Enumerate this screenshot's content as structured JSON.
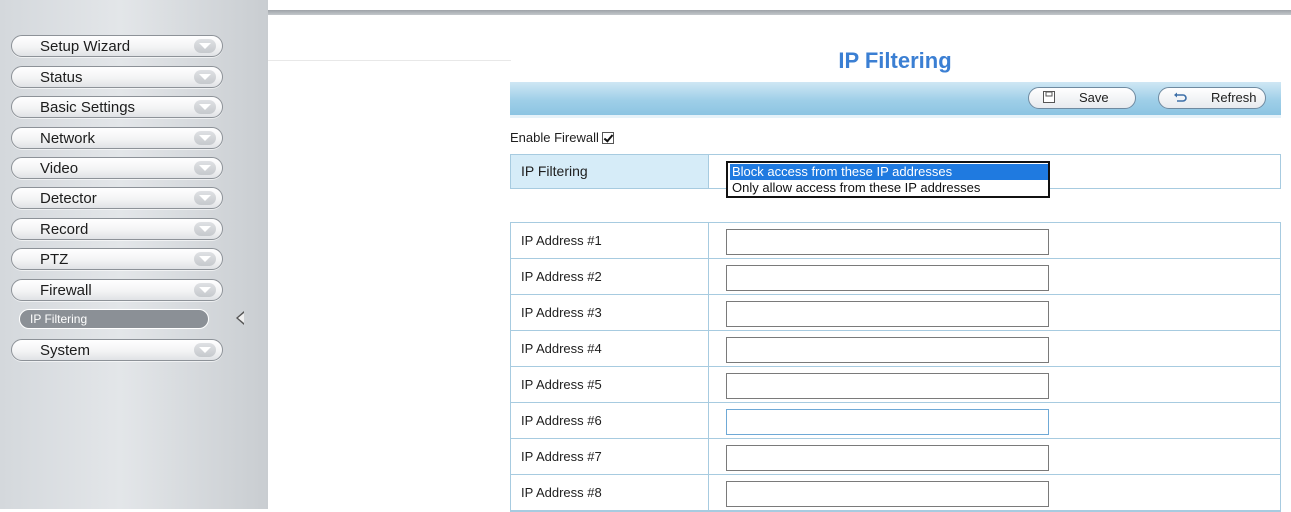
{
  "sidebar": {
    "items": [
      {
        "label": "Setup Wizard"
      },
      {
        "label": "Status"
      },
      {
        "label": "Basic Settings"
      },
      {
        "label": "Network"
      },
      {
        "label": "Video"
      },
      {
        "label": "Detector"
      },
      {
        "label": "Record"
      },
      {
        "label": "PTZ"
      },
      {
        "label": "Firewall"
      },
      {
        "label": "System"
      }
    ],
    "sub_item": {
      "label": "IP Filtering"
    }
  },
  "main": {
    "title": "IP Filtering",
    "toolbar": {
      "save_label": "Save",
      "refresh_label": "Refresh"
    },
    "enable_firewall": {
      "label": "Enable Firewall",
      "checked": true
    },
    "filtering": {
      "label": "IP Filtering",
      "options": [
        "Block access from these IP addresses",
        "Only allow access from these IP addresses"
      ],
      "selected": "Block access from these IP addresses"
    },
    "ip_rows": [
      {
        "label": "IP Address #1",
        "value": ""
      },
      {
        "label": "IP Address #2",
        "value": ""
      },
      {
        "label": "IP Address #3",
        "value": ""
      },
      {
        "label": "IP Address #4",
        "value": ""
      },
      {
        "label": "IP Address #5",
        "value": ""
      },
      {
        "label": "IP Address #6",
        "value": ""
      },
      {
        "label": "IP Address #7",
        "value": ""
      },
      {
        "label": "IP Address #8",
        "value": ""
      }
    ]
  },
  "colors": {
    "title": "#3b7fd3",
    "toolbar": "#9fcfe8",
    "selected_option": "#1f7ae0",
    "table_border": "#a7cbe0"
  }
}
